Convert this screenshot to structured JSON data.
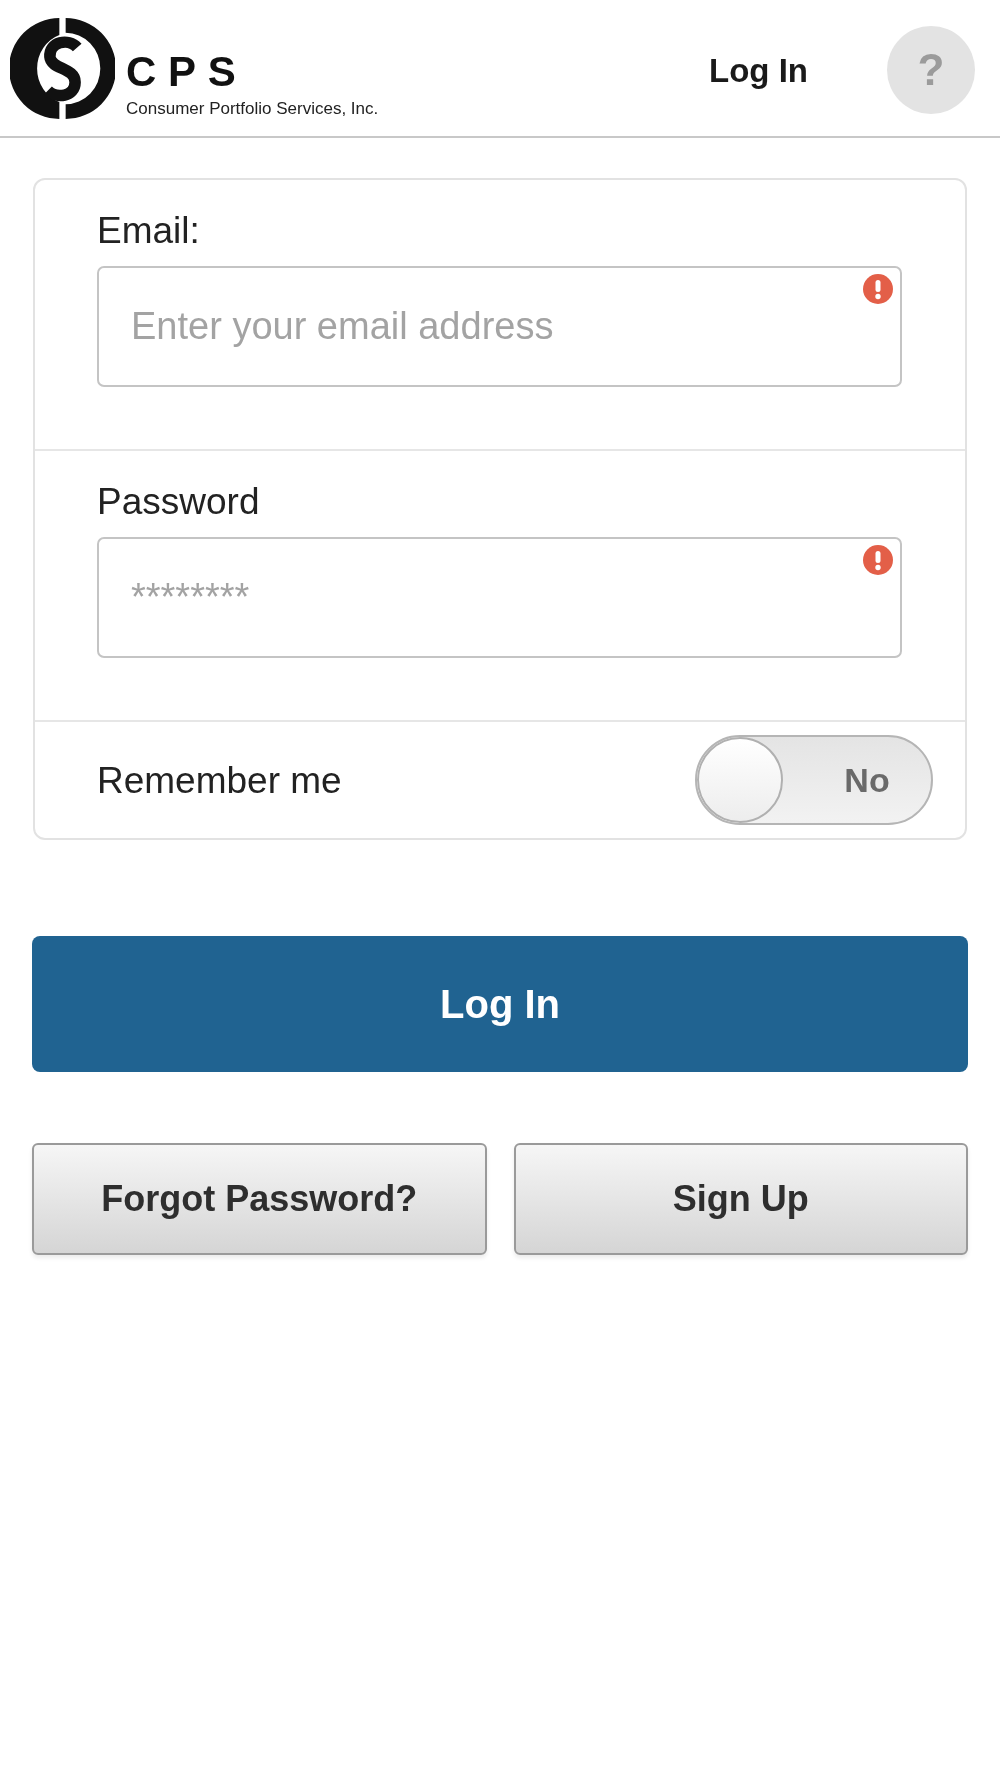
{
  "header": {
    "logo": {
      "wordmark": "CPS",
      "company": "Consumer Portfolio Services, Inc."
    },
    "title": "Log In",
    "help_button": "?"
  },
  "form": {
    "fields": [
      {
        "label": "Email:",
        "placeholder": "Enter your email address",
        "error": true
      },
      {
        "label": "Password",
        "placeholder": "********",
        "error": true
      }
    ],
    "remember_me": {
      "label": "Remember me",
      "on": false,
      "state_label": "No"
    }
  },
  "login_button": "Log In",
  "secondary_buttons": [
    "Forgot Password?",
    "Sign Up"
  ]
}
